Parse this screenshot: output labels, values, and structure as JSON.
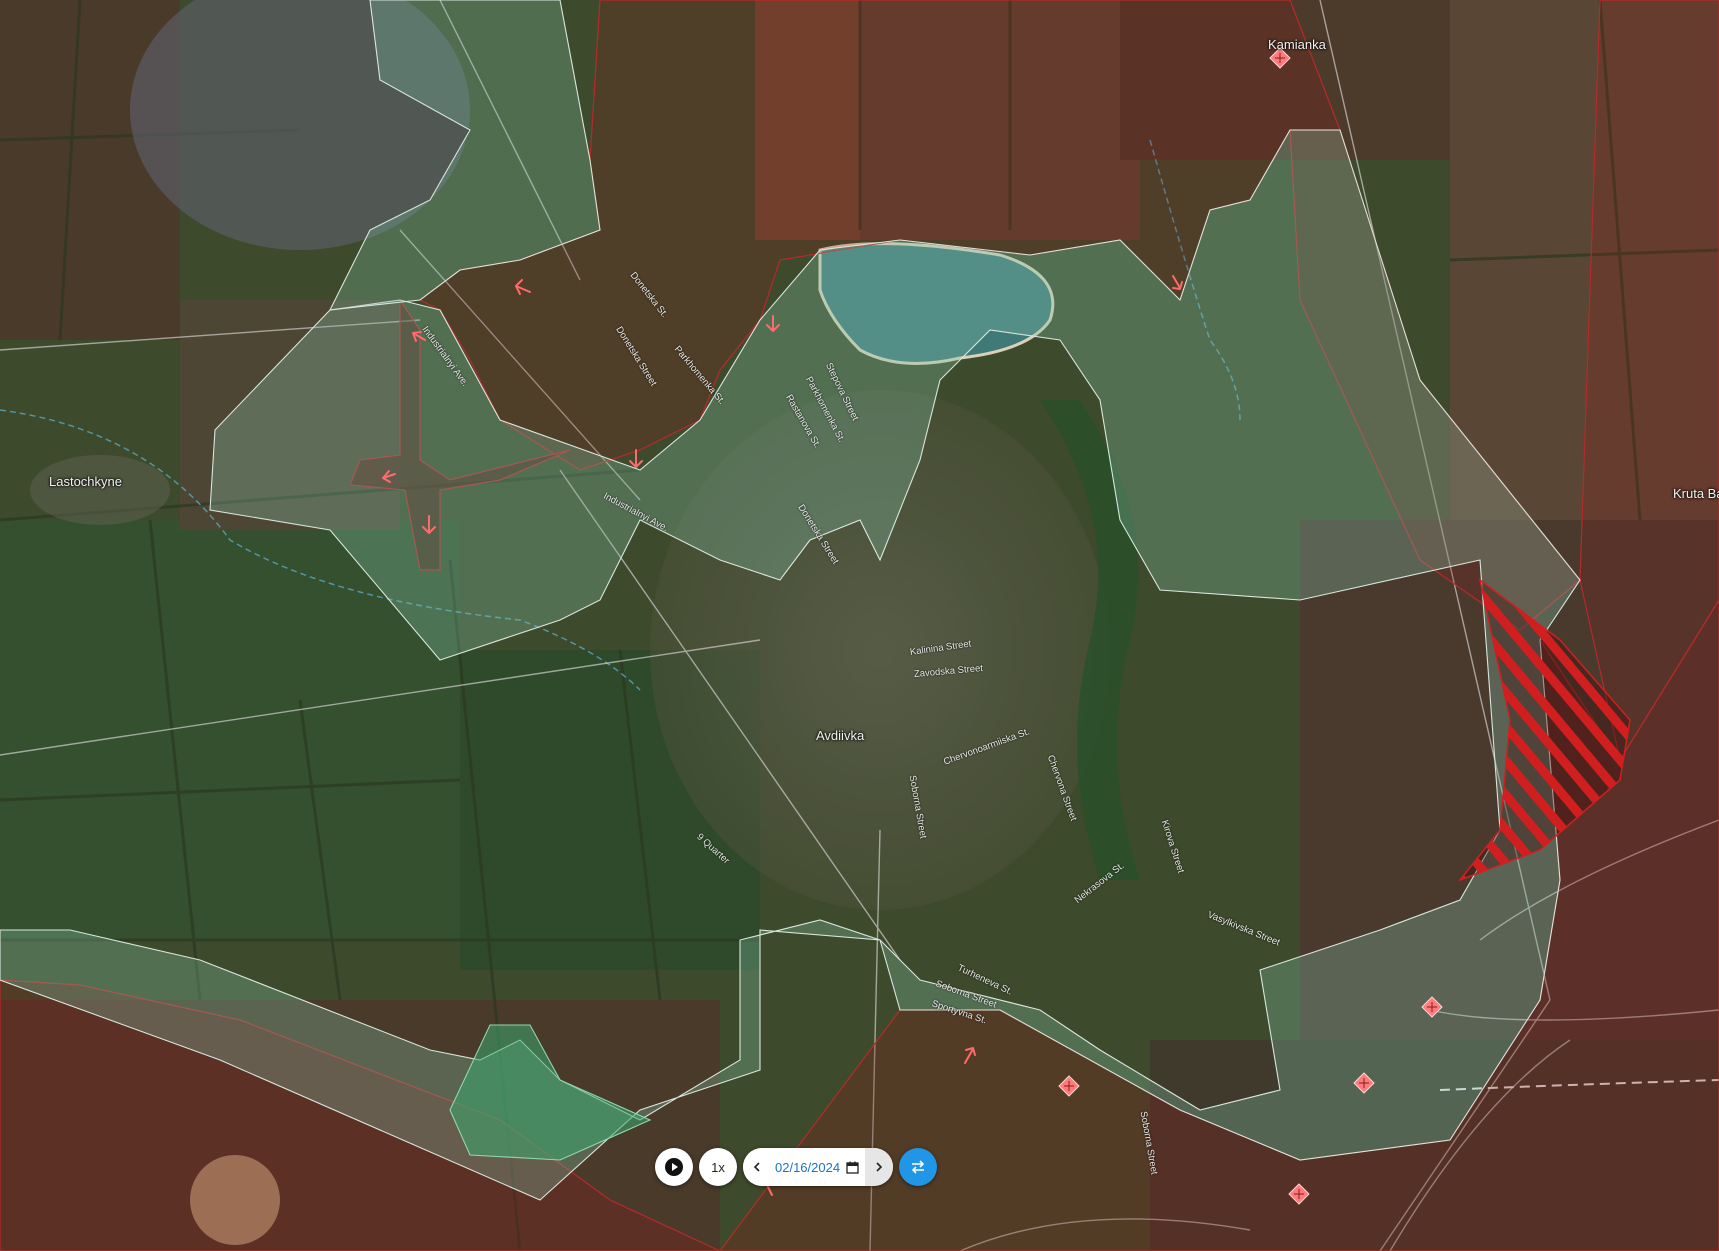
{
  "map": {
    "places": [
      {
        "id": "kamianka",
        "label": "Kamianka"
      },
      {
        "id": "lastochkyne",
        "label": "Lastochkyne"
      },
      {
        "id": "avdiivka",
        "label": "Avdiivka"
      },
      {
        "id": "kruta-balka",
        "label": "Kruta Ba"
      }
    ],
    "streets": [
      "Donetska St.",
      "Donetska Street",
      "Parkhomenka St.",
      "Stepova Street",
      "Parkhomenka St.",
      "Rastanova St.",
      "Industrialnyi Ave.",
      "Industrialnyi Ave.",
      "Donetska Street",
      "Kalinina Street",
      "Zavodska Street",
      "Chervonoarmiiska St.",
      "Chervona Street",
      "Sobornа Street",
      "9 Quarter",
      "Nekrasova St.",
      "Kirova Street",
      "Vasylkivska Street",
      "Turheneva St.",
      "Soborna Street",
      "Sportyvna St.",
      "Soborna Street"
    ],
    "colors": {
      "russian_control": "#8b1a1a",
      "ukrainian_control": "#7fbfa6",
      "contested_hatch": "#d11f1f",
      "advance_arrow": "#ff6b6b",
      "marker": "#ff7b7b"
    }
  },
  "controls": {
    "play_icon": "play-icon",
    "speed_label": "1x",
    "prev_icon": "chevron-left-icon",
    "date_value": "02/16/2024",
    "calendar_icon": "calendar-icon",
    "next_icon": "chevron-right-icon",
    "swap_icon": "swap-icon"
  }
}
